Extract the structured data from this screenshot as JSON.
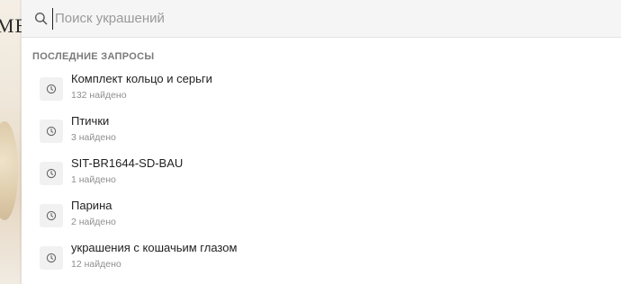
{
  "background": {
    "logo_fragment": "ME"
  },
  "search": {
    "placeholder": "Поиск украшений",
    "value": ""
  },
  "recent": {
    "title": "ПОСЛЕДНИЕ ЗАПРОСЫ",
    "items": [
      {
        "query": "Комплект кольцо и серьги",
        "count": "132 найдено"
      },
      {
        "query": "Птички",
        "count": "3 найдено"
      },
      {
        "query": "SIT-BR1644-SD-BAU",
        "count": "1 найдено"
      },
      {
        "query": "Парина",
        "count": "2 найдено"
      },
      {
        "query": "украшения с кошачьим глазом",
        "count": "12 найдено"
      }
    ]
  },
  "icons": {
    "search": "search-icon",
    "history": "clock-icon"
  }
}
